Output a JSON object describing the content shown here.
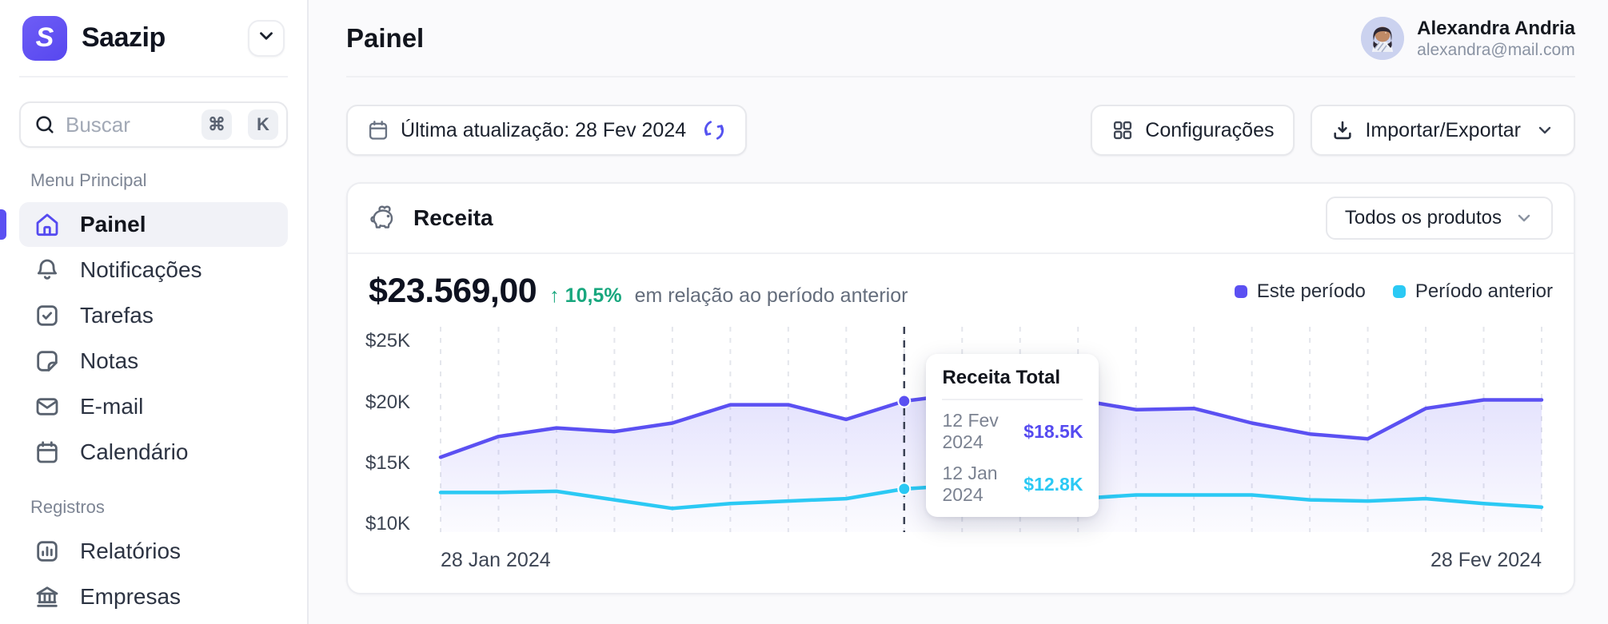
{
  "brand": {
    "name": "Saazip",
    "logo_letter": "S",
    "accent": "#5B50F2"
  },
  "sidebar": {
    "search": {
      "placeholder": "Buscar",
      "shortcut_keys": [
        "⌘",
        "K"
      ]
    },
    "sections": [
      {
        "label": "Menu Principal",
        "items": [
          {
            "label": "Painel",
            "icon": "home",
            "active": true
          },
          {
            "label": "Notificações",
            "icon": "bell",
            "active": false
          },
          {
            "label": "Tarefas",
            "icon": "task-check",
            "active": false
          },
          {
            "label": "Notas",
            "icon": "note",
            "active": false
          },
          {
            "label": "E-mail",
            "icon": "envelope",
            "active": false
          },
          {
            "label": "Calendário",
            "icon": "calendar",
            "active": false
          }
        ]
      },
      {
        "label": "Registros",
        "items": [
          {
            "label": "Relatórios",
            "icon": "bar-chart",
            "active": false
          },
          {
            "label": "Empresas",
            "icon": "bank",
            "active": false
          }
        ]
      }
    ]
  },
  "header": {
    "title": "Painel",
    "user": {
      "name": "Alexandra Andria",
      "email": "alexandra@mail.com"
    }
  },
  "toolbar": {
    "last_update_label": "Última atualização: 28 Fev 2024",
    "settings_label": "Configurações",
    "import_export_label": "Importar/Exportar"
  },
  "revenue_card": {
    "title": "Receita",
    "filter_label": "Todos os produtos",
    "total": "$23.569,00",
    "delta_arrow": "↑",
    "delta": "10,5%",
    "delta_color": "#18A77E",
    "delta_caption": "em relação ao período anterior",
    "legend": [
      {
        "label": "Este período",
        "color": "#5B50F2"
      },
      {
        "label": "Período anterior",
        "color": "#2BC9F4"
      }
    ],
    "tooltip": {
      "title": "Receita Total",
      "rows": [
        {
          "date": "12 Fev 2024",
          "value": "$18.5K",
          "color": "#554AF0"
        },
        {
          "date": "12 Jan 2024",
          "value": "$12.8K",
          "color": "#2BC9F4"
        }
      ]
    }
  },
  "chart_data": {
    "type": "area",
    "title": "Receita",
    "x_start_label": "28 Jan 2024",
    "x_end_label": "28 Fev 2024",
    "y_ticks": [
      "$25K",
      "$20K",
      "$15K",
      "$10K"
    ],
    "y_tick_values": [
      25,
      20,
      15,
      10
    ],
    "ylim": [
      9.35,
      26.2
    ],
    "unit": "thousand USD",
    "grid": "vertical-dashed",
    "legend_position": "top-right",
    "hover_index": 8,
    "series": [
      {
        "name": "Este período",
        "color": "#5B50F2",
        "values": [
          15.5,
          17.2,
          17.9,
          17.6,
          18.3,
          19.8,
          19.8,
          18.6,
          20.1,
          20.7,
          21.0,
          20.2,
          19.4,
          19.5,
          18.3,
          17.4,
          17.0,
          19.5,
          20.2,
          20.2
        ]
      },
      {
        "name": "Período anterior",
        "color": "#2BC9F4",
        "values": [
          12.6,
          12.6,
          12.7,
          12.0,
          11.3,
          11.7,
          11.9,
          12.1,
          12.9,
          13.2,
          12.6,
          12.1,
          12.4,
          12.4,
          12.4,
          12.0,
          11.9,
          12.1,
          11.7,
          11.4
        ]
      }
    ]
  }
}
